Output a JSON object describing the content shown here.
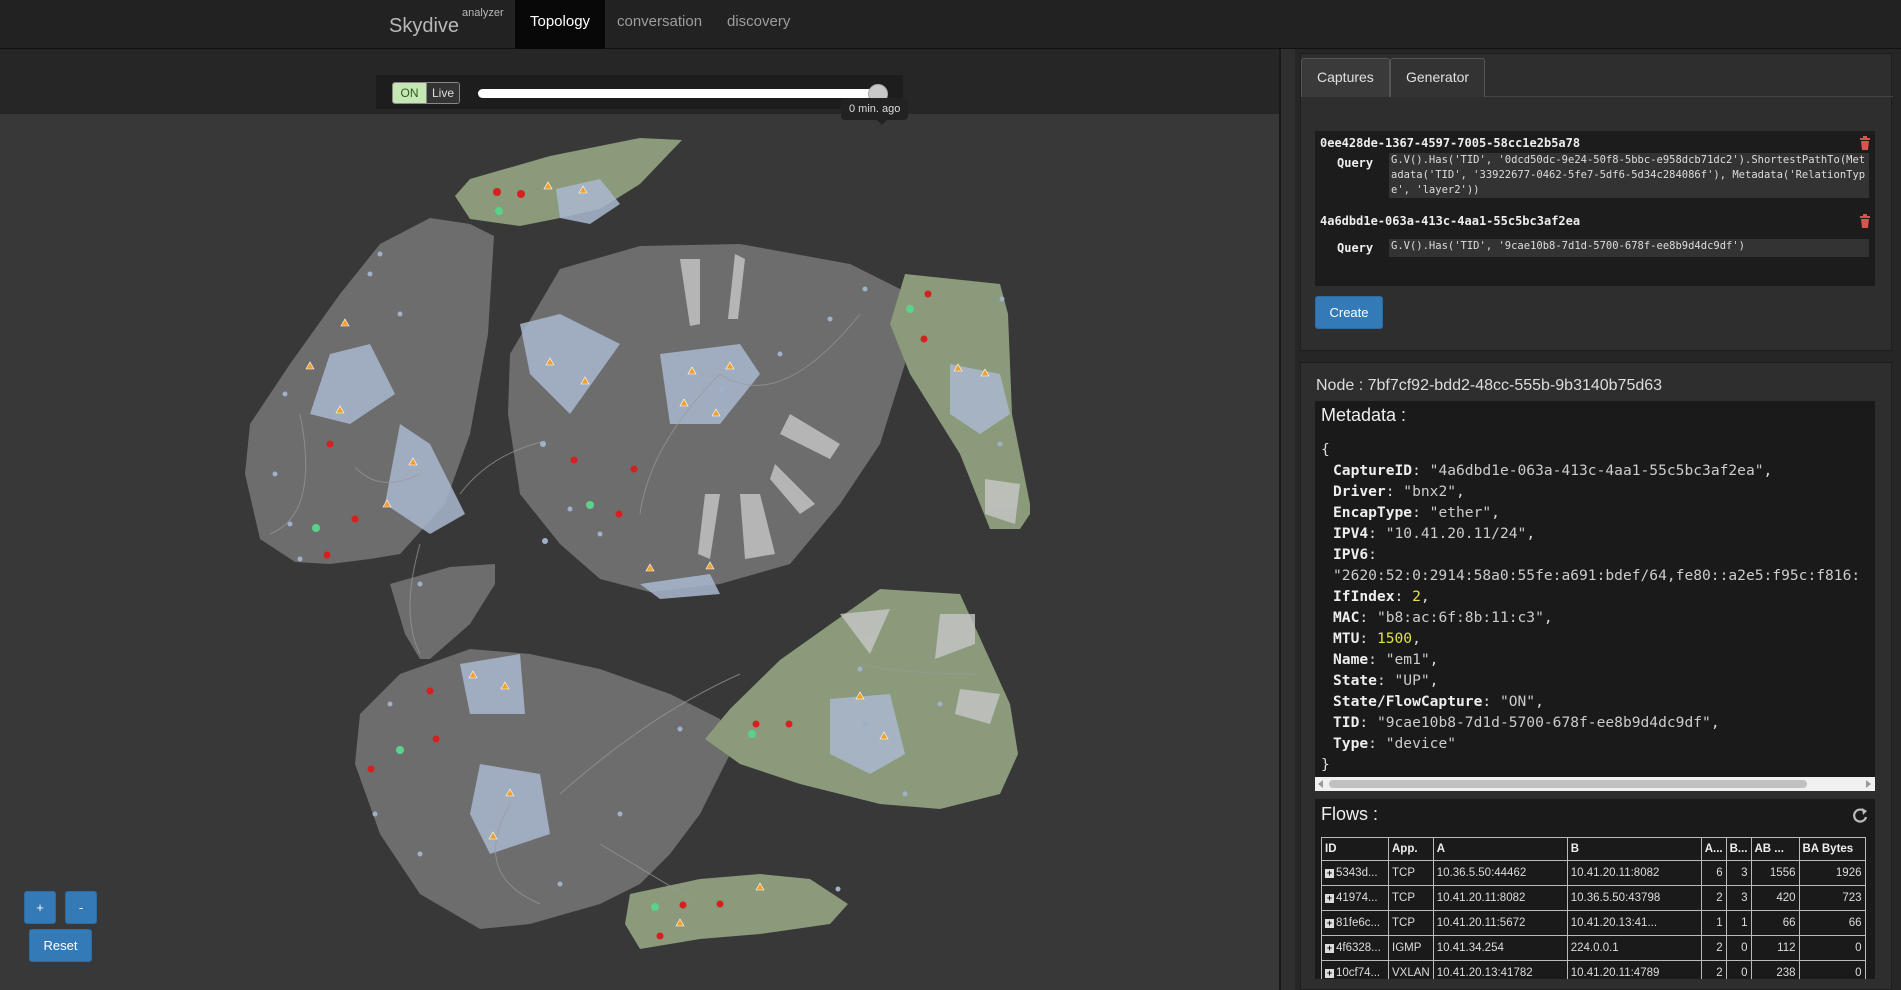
{
  "nav": {
    "brand": "Skydive",
    "brand_sup": "analyzer",
    "tabs": [
      "Topology",
      "conversation",
      "discovery"
    ]
  },
  "timeslider": {
    "on_label": "ON",
    "live_label": "Live",
    "tooltip": "0 min. ago",
    "value": 1.0
  },
  "zoom": {
    "plus": "+",
    "minus": "-",
    "reset": "Reset"
  },
  "captures_panel": {
    "tabs": [
      "Captures",
      "Generator"
    ],
    "captures": [
      {
        "id": "0ee428de-1367-4597-7005-58cc1e2b5a78",
        "query_label": "Query",
        "query": "G.V().Has('TID', '0dcd50dc-9e24-50f8-5bbc-e958dcb71dc2').ShortestPathTo(Metadata('TID', '33922677-0462-5fe7-5df6-5d34c284086f'), Metadata('RelationType', 'layer2'))"
      },
      {
        "id": "4a6dbd1e-063a-413c-4aa1-55c5bc3af2ea",
        "query_label": "Query",
        "query": "G.V().Has('TID', '9cae10b8-7d1d-5700-678f-ee8b9d4dc9df')"
      }
    ],
    "create_label": "Create"
  },
  "node_panel": {
    "title": "Node : 7bf7cf92-bdd2-48cc-555b-9b3140b75d63",
    "metadata_label": "Metadata :",
    "metadata": [
      {
        "key": "CaptureID",
        "value": "\"4a6dbd1e-063a-413c-4aa1-55c5bc3af2ea\"",
        "type": "string"
      },
      {
        "key": "Driver",
        "value": "\"bnx2\"",
        "type": "string"
      },
      {
        "key": "EncapType",
        "value": "\"ether\"",
        "type": "string"
      },
      {
        "key": "IPV4",
        "value": "\"10.41.20.11/24\"",
        "type": "string"
      },
      {
        "key": "IPV6",
        "value": "\"2620:52:0:2914:58a0:55fe:a691:bdef/64,fe80::a2e5:f95c:f816:",
        "type": "string-wrap"
      },
      {
        "key": "IfIndex",
        "value": "2",
        "type": "number"
      },
      {
        "key": "MAC",
        "value": "\"b8:ac:6f:8b:11:c3\"",
        "type": "string"
      },
      {
        "key": "MTU",
        "value": "1500",
        "type": "number"
      },
      {
        "key": "Name",
        "value": "\"em1\"",
        "type": "string"
      },
      {
        "key": "State",
        "value": "\"UP\"",
        "type": "string"
      },
      {
        "key": "State/FlowCapture",
        "value": "\"ON\"",
        "type": "string"
      },
      {
        "key": "TID",
        "value": "\"9cae10b8-7d1d-5700-678f-ee8b9d4dc9df\"",
        "type": "string"
      },
      {
        "key": "Type",
        "value": "\"device\"",
        "type": "string-last"
      }
    ],
    "flows_label": "Flows :",
    "flow_columns": [
      "ID",
      "App.",
      "A",
      "B",
      "A...",
      "B...",
      "AB ...",
      "BA Bytes"
    ],
    "flows": [
      [
        "5343d...",
        "TCP",
        "10.36.5.50:44462",
        "10.41.20.11:8082",
        "6",
        "3",
        "1556",
        "1926"
      ],
      [
        "41974...",
        "TCP",
        "10.41.20.11:8082",
        "10.36.5.50:43798",
        "2",
        "3",
        "420",
        "723"
      ],
      [
        "81fe6c...",
        "TCP",
        "10.41.20.11:5672",
        "10.41.20.13:41...",
        "1",
        "1",
        "66",
        "66"
      ],
      [
        "4f6328...",
        "IGMP",
        "10.41.34.254",
        "224.0.0.1",
        "2",
        "0",
        "112",
        "0"
      ],
      [
        "10cf74...",
        "VXLAN",
        "10.41.20.13:41782",
        "10.41.20.11:4789",
        "2",
        "0",
        "238",
        "0"
      ]
    ]
  },
  "colors": {
    "host_hull": "#6d6d6d",
    "netns_hull": "#8a9a7a",
    "bridge_hull": "#a9b7cf",
    "node_red": "#d62020",
    "node_green": "#5bd28a",
    "node_orange": "#f0a030",
    "accent_blue": "#337ab7"
  }
}
